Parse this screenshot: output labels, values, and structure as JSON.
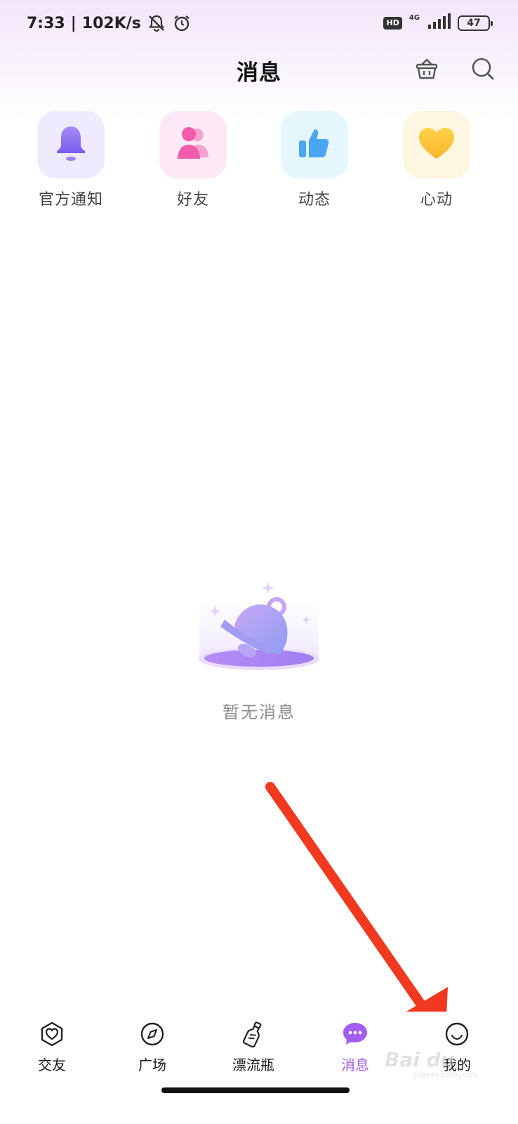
{
  "status_bar": {
    "time": "7:33",
    "separator": "|",
    "speed": "102K/s",
    "hd": "HD",
    "network": "4G",
    "battery": "47"
  },
  "header": {
    "title": "消息"
  },
  "categories": [
    {
      "label": "官方通知",
      "icon": "bell-icon",
      "bg": "#efeafd"
    },
    {
      "label": "好友",
      "icon": "friends-icon",
      "bg": "#fde9f5"
    },
    {
      "label": "动态",
      "icon": "thumbs-up-icon",
      "bg": "#e5f6fd"
    },
    {
      "label": "心动",
      "icon": "heart-icon",
      "bg": "#fdf6e0"
    }
  ],
  "empty_state": {
    "text": "暂无消息"
  },
  "bottom_nav": {
    "items": [
      {
        "label": "交友",
        "icon": "heart-shield-icon",
        "active": false
      },
      {
        "label": "广场",
        "icon": "compass-icon",
        "active": false
      },
      {
        "label": "漂流瓶",
        "icon": "bottle-icon",
        "active": false
      },
      {
        "label": "消息",
        "icon": "chat-bubble-icon",
        "active": true
      },
      {
        "label": "我的",
        "icon": "profile-icon",
        "active": false
      }
    ]
  },
  "colors": {
    "accent": "#a45cf0",
    "annotation_arrow": "#f0391e"
  },
  "watermark": {
    "main": "Bai du",
    "sub": "jingyan.baidu.com"
  }
}
